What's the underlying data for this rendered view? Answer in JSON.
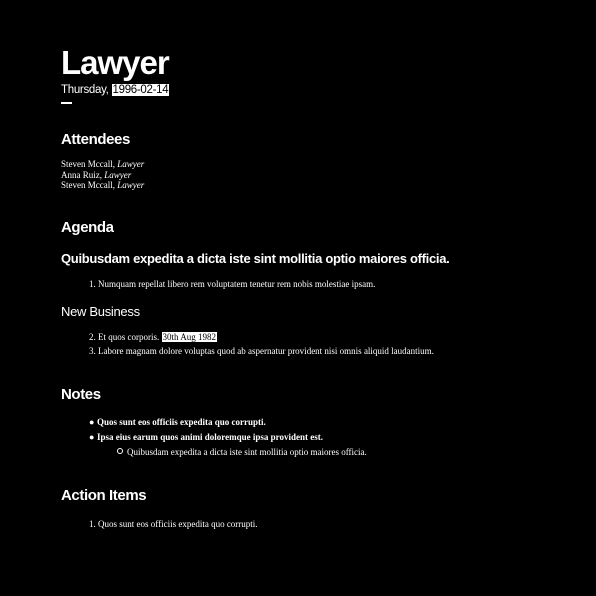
{
  "title": "Lawyer",
  "date": {
    "weekday": "Thursday,",
    "value": "1996-02-14"
  },
  "attendees": {
    "heading": "Attendees",
    "people": [
      {
        "name": "Steven Mccall,",
        "role": "Lawyer"
      },
      {
        "name": "Anna Ruiz,",
        "role": "Lawyer"
      },
      {
        "name": "Steven Mccall,",
        "role": "Lawyer"
      }
    ]
  },
  "agenda": {
    "heading": "Agenda",
    "subheading": "Quibusdam expedita a dicta iste sint mollitia optio maiores officia.",
    "items": [
      {
        "num": "1.",
        "text": "Numquam repellat libero rem voluptatem tenetur rem nobis molestiae ipsam."
      }
    ],
    "new_business": {
      "heading": "New Business",
      "item2_num": "2.",
      "item2_text": "Et quos corporis.",
      "item2_date": "30th Aug 1982",
      "item3_num": "3.",
      "item3_text": "Labore magnam dolore voluptas quod ab aspernatur provident nisi omnis aliquid laudantium."
    }
  },
  "notes": {
    "heading": "Notes",
    "bullets": [
      {
        "text": "Quos sunt eos officiis expedita quo corrupti."
      },
      {
        "text": "Ipsa eius earum quos animi doloremque ipsa provident est."
      }
    ],
    "sub_bullet": "Quibusdam expedita a dicta iste sint mollitia optio maiores officia."
  },
  "action_items": {
    "heading": "Action Items",
    "items": [
      {
        "num": "1.",
        "text": "Quos sunt eos officiis expedita quo corrupti."
      }
    ]
  }
}
